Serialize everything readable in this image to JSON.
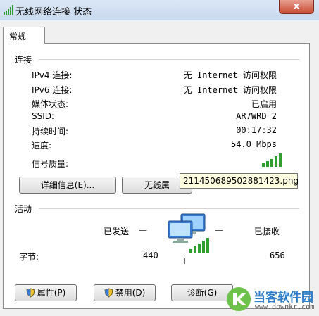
{
  "window": {
    "title": "无线网络连接 状态",
    "close_label": "x"
  },
  "tab": {
    "label": "常规"
  },
  "connection": {
    "heading": "连接",
    "rows": [
      {
        "label": "IPv4 连接:",
        "value": "无 Internet 访问权限"
      },
      {
        "label": "IPv6 连接:",
        "value": "无 Internet 访问权限"
      },
      {
        "label": "媒体状态:",
        "value": "已启用"
      },
      {
        "label": "SSID:",
        "value": "AR7WRD 2"
      },
      {
        "label": "持续时间:",
        "value": "00:17:32"
      },
      {
        "label": "速度:",
        "value": "54.0 Mbps"
      },
      {
        "label": "信号质量:",
        "value": ""
      }
    ],
    "signal_bars": 5
  },
  "buttons": {
    "details": "详细信息(E)...",
    "wireless_props": "无线属"
  },
  "tooltip": {
    "text": "211450689502881423.png"
  },
  "activity": {
    "heading": "活动",
    "sent_label": "已发送",
    "received_label": "已接收",
    "bytes_label": "字节:",
    "bytes_sent": "440",
    "bytes_received": "656",
    "divider_glyph": "—"
  },
  "bottom_buttons": {
    "properties": "属性(P)",
    "disable": "禁用(D)",
    "diagnose": "诊断(G)"
  },
  "watermark": {
    "brand": "当客软件园",
    "url": "www.downkr.com"
  },
  "colors": {
    "signal_green": "#2e9e2e",
    "accent_blue": "#2f7ec8"
  }
}
